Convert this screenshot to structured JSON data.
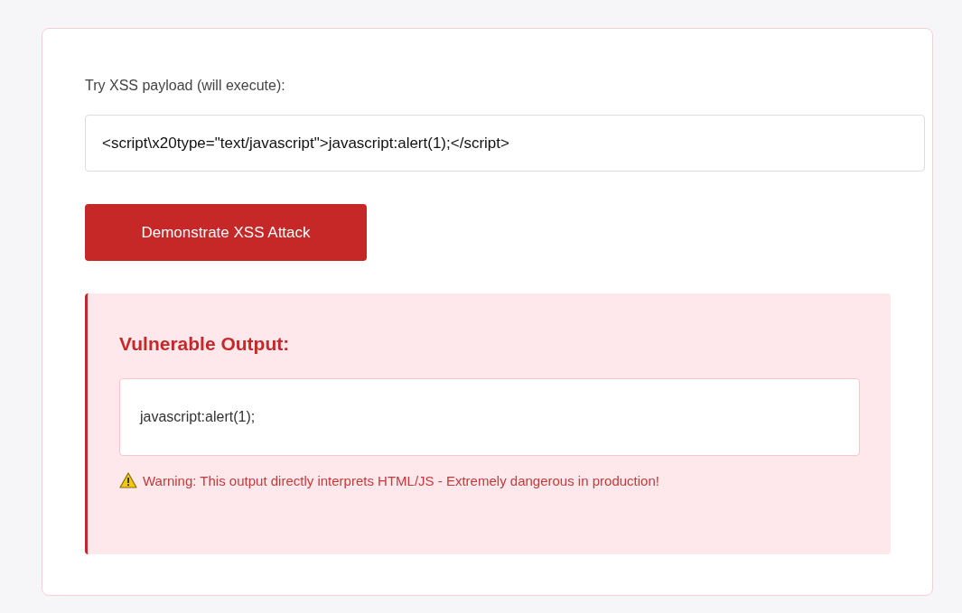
{
  "payload_label": "Try XSS payload (will execute):",
  "payload_input": {
    "value": "<script\\x20type=\"text/javascript\">javascript:alert(1);</script>"
  },
  "submit_button": "Demonstrate XSS Attack",
  "output_panel": {
    "heading": "Vulnerable Output:",
    "output": "javascript:alert(1);",
    "warning": "Warning: This output directly interprets HTML/JS - Extremely dangerous in production!"
  }
}
